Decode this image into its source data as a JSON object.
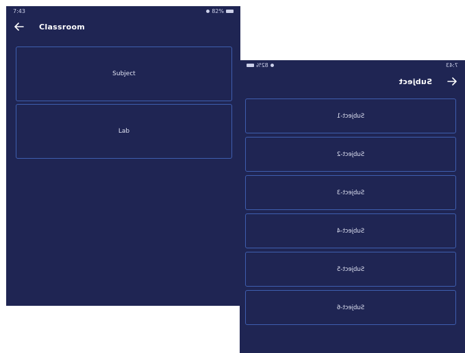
{
  "left_screen": {
    "status": {
      "time": "7:43",
      "battery": "82%"
    },
    "title": "Classroom",
    "items": [
      {
        "label": "Subject"
      },
      {
        "label": "Lab"
      }
    ]
  },
  "right_screen": {
    "status": {
      "time": "7:43",
      "battery": "82%"
    },
    "title": "Subject",
    "items": [
      {
        "label": "Subject-1"
      },
      {
        "label": "Subject-2"
      },
      {
        "label": "Subject-3"
      },
      {
        "label": "Subject-4"
      },
      {
        "label": "Subject-5"
      },
      {
        "label": "Subject-6"
      }
    ]
  },
  "colors": {
    "background": "#1f2553",
    "card_border": "#3f5fb0",
    "text": "#e1e4f4"
  }
}
